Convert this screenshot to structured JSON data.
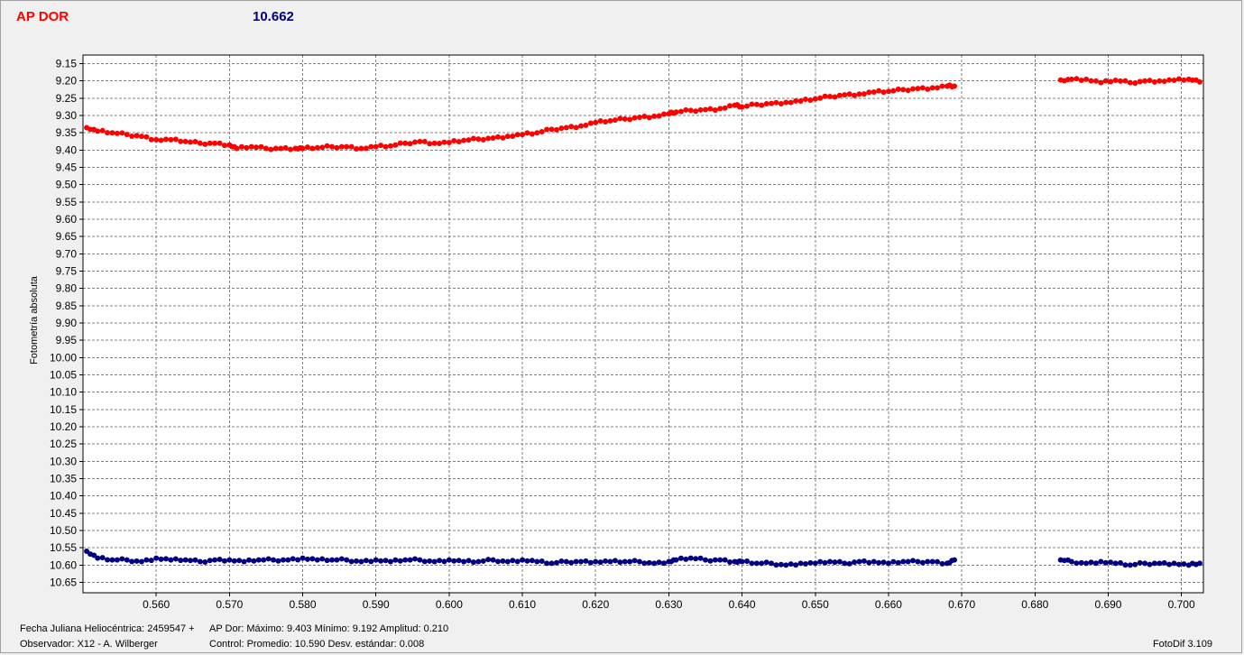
{
  "header": {
    "star_name": "AP DOR",
    "value": "10.662"
  },
  "footer": {
    "jd_label": "Fecha Juliana Heliocéntrica: 2459547 +",
    "observer": "Observador: X12 - A. Wilberger",
    "var_stats": "AP Dor:  Máximo: 9.403   Mínimo: 9.192   Amplitud: 0.210",
    "ctrl_stats": "Control:  Promedio: 10.590   Desv. estándar: 0.008",
    "software": "FotoDif 3.109"
  },
  "colors": {
    "variable": "#ff0000",
    "control": "#000080",
    "plot_bg": "#ffffff",
    "grid": "#808080"
  },
  "chart_data": {
    "type": "scatter",
    "title": "",
    "xlabel": "",
    "ylabel": "Fotometría absoluta",
    "xlim": [
      0.55,
      0.703
    ],
    "ylim": [
      9.125,
      10.68
    ],
    "y_inverted": true,
    "grid": true,
    "x_ticks": [
      "0.560",
      "0.570",
      "0.580",
      "0.590",
      "0.600",
      "0.610",
      "0.620",
      "0.630",
      "0.640",
      "0.650",
      "0.660",
      "0.670",
      "0.680",
      "0.690",
      "0.700"
    ],
    "y_ticks": [
      "9.15",
      "9.20",
      "9.25",
      "9.30",
      "9.35",
      "9.40",
      "9.45",
      "9.50",
      "9.55",
      "9.60",
      "9.65",
      "9.70",
      "9.75",
      "9.80",
      "9.85",
      "9.90",
      "9.95",
      "10.00",
      "10.05",
      "10.10",
      "10.15",
      "10.20",
      "10.25",
      "10.30",
      "10.35",
      "10.40",
      "10.45",
      "10.50",
      "10.55",
      "10.60",
      "10.65"
    ],
    "series": [
      {
        "color": "#ff0000",
        "x": [
          0.5505,
          0.552,
          0.554,
          0.556,
          0.558,
          0.56,
          0.562,
          0.564,
          0.566,
          0.568,
          0.57,
          0.571,
          0.573,
          0.575,
          0.577,
          0.579,
          0.58,
          0.582,
          0.584,
          0.586,
          0.588,
          0.59,
          0.592,
          0.594,
          0.596,
          0.598,
          0.6,
          0.602,
          0.604,
          0.606,
          0.608,
          0.61,
          0.612,
          0.614,
          0.616,
          0.618,
          0.62,
          0.622,
          0.624,
          0.626,
          0.628,
          0.63,
          0.631,
          0.633,
          0.635,
          0.637,
          0.639,
          0.64,
          0.642,
          0.644,
          0.646,
          0.648,
          0.65,
          0.652,
          0.654,
          0.656,
          0.658,
          0.66,
          0.662,
          0.664,
          0.666,
          0.668,
          0.669,
          0.6835,
          0.685,
          0.687,
          0.689,
          0.691,
          0.693,
          0.695,
          0.697,
          0.699,
          0.701,
          0.7025
        ],
        "y": [
          9.335,
          9.345,
          9.35,
          9.355,
          9.36,
          9.37,
          9.37,
          9.375,
          9.38,
          9.38,
          9.385,
          9.395,
          9.39,
          9.395,
          9.395,
          9.395,
          9.395,
          9.393,
          9.39,
          9.39,
          9.395,
          9.39,
          9.388,
          9.38,
          9.375,
          9.38,
          9.378,
          9.372,
          9.368,
          9.365,
          9.36,
          9.355,
          9.35,
          9.34,
          9.335,
          9.33,
          9.32,
          9.315,
          9.31,
          9.305,
          9.302,
          9.295,
          9.29,
          9.285,
          9.283,
          9.28,
          9.27,
          9.275,
          9.268,
          9.265,
          9.262,
          9.258,
          9.252,
          9.245,
          9.24,
          9.238,
          9.232,
          9.23,
          9.225,
          9.222,
          9.22,
          9.215,
          9.215,
          9.197,
          9.195,
          9.195,
          9.205,
          9.198,
          9.205,
          9.2,
          9.2,
          9.198,
          9.195,
          9.203
        ]
      },
      {
        "color": "#000080",
        "x": [
          0.5505,
          0.552,
          0.554,
          0.556,
          0.558,
          0.56,
          0.562,
          0.564,
          0.566,
          0.568,
          0.57,
          0.572,
          0.574,
          0.576,
          0.578,
          0.58,
          0.582,
          0.584,
          0.586,
          0.588,
          0.59,
          0.592,
          0.594,
          0.596,
          0.598,
          0.6,
          0.602,
          0.604,
          0.606,
          0.608,
          0.61,
          0.612,
          0.614,
          0.616,
          0.618,
          0.62,
          0.622,
          0.624,
          0.626,
          0.628,
          0.63,
          0.631,
          0.633,
          0.635,
          0.637,
          0.639,
          0.64,
          0.642,
          0.644,
          0.646,
          0.648,
          0.65,
          0.652,
          0.654,
          0.656,
          0.658,
          0.66,
          0.662,
          0.664,
          0.666,
          0.668,
          0.669,
          0.6835,
          0.685,
          0.687,
          0.689,
          0.691,
          0.693,
          0.695,
          0.697,
          0.699,
          0.701,
          0.7025
        ],
        "y": [
          10.56,
          10.58,
          10.585,
          10.585,
          10.59,
          10.58,
          10.585,
          10.585,
          10.59,
          10.585,
          10.585,
          10.59,
          10.585,
          10.585,
          10.585,
          10.58,
          10.585,
          10.585,
          10.585,
          10.59,
          10.585,
          10.59,
          10.585,
          10.585,
          10.59,
          10.585,
          10.59,
          10.59,
          10.585,
          10.59,
          10.585,
          10.59,
          10.595,
          10.59,
          10.59,
          10.59,
          10.59,
          10.59,
          10.59,
          10.595,
          10.59,
          10.585,
          10.58,
          10.585,
          10.585,
          10.59,
          10.59,
          10.595,
          10.595,
          10.6,
          10.595,
          10.595,
          10.59,
          10.595,
          10.59,
          10.59,
          10.595,
          10.59,
          10.59,
          10.59,
          10.595,
          10.585,
          10.585,
          10.59,
          10.595,
          10.59,
          10.595,
          10.6,
          10.595,
          10.595,
          10.595,
          10.6,
          10.595
        ]
      }
    ]
  }
}
